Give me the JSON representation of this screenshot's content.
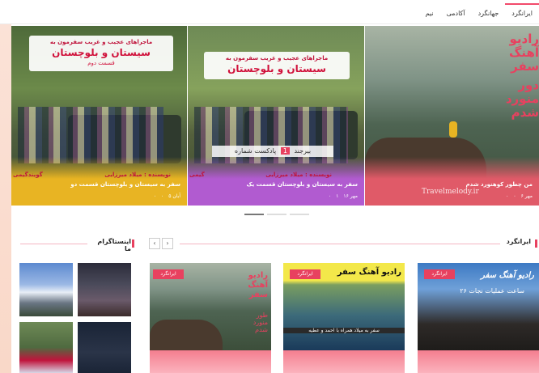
{
  "nav": {
    "tabs": [
      {
        "label": "ایرانگرد"
      },
      {
        "label": "جهانگرد"
      },
      {
        "label": "آکادمی"
      },
      {
        "label": "نیم"
      }
    ]
  },
  "slider": {
    "slides": [
      {
        "banner_line1": "رادیو آهنگ سفر",
        "banner_line2": "دور منورد شدم",
        "caption": "من چطور کوهنورد شدم",
        "date": "۶ مهر",
        "comments": "۰",
        "views": "۰"
      },
      {
        "banner_line1": "ماجراهای عجیب و غریب سفرمون به",
        "banner_line2": "سیستان و بلوچستان",
        "episode_label": "پادکست شماره",
        "episode_number": "1",
        "brand": "بیرجند",
        "author": "نویسنده : میلاد میرزایی",
        "caption": "سفر به سیستان و بلوچستان قسمت یک",
        "date": "۱۶ مهر",
        "comments": "۱",
        "views": "۰",
        "edge_text": "گیمی"
      },
      {
        "banner_line1": "ماجراهای عجیب و غریب سفرمون به",
        "banner_line2": "سیستان و بلوچستان",
        "banner_line3": "قسمت دوم",
        "author": "نویسنده : میلاد میرزایی",
        "caption": "سفر به سیستان و بلوچستان قسمت دو",
        "date": "۵ آبان",
        "comments": "۰",
        "views": "۰",
        "edge_text": "گویندگیمی"
      }
    ],
    "watermark": "Travelmelody.ir"
  },
  "section_main": {
    "title": "ایرانگرد"
  },
  "section_insta": {
    "title": "اینستاگرام ما"
  },
  "cards": [
    {
      "badge": "ایرانگرد",
      "title": "رادیو آهنگ سفر",
      "subtitle": "۲۶ ساعت عملیات نجات"
    },
    {
      "badge": "ایرانگرد",
      "title": "رادیو آهنگ سفر",
      "subtitle": "سفر به میلاد همراه با احمد و عطیه"
    },
    {
      "badge": "ایرانگرد",
      "title": "رادیو آهنگ سفر",
      "subtitle": "طور منورد شدم"
    }
  ],
  "colors": {
    "accent": "#e8415f",
    "nav_active": "#f24a6b",
    "slide1_fade": "#e05a68",
    "slide2_fade": "#b15bd0",
    "slide3_fade": "#e8b423"
  }
}
